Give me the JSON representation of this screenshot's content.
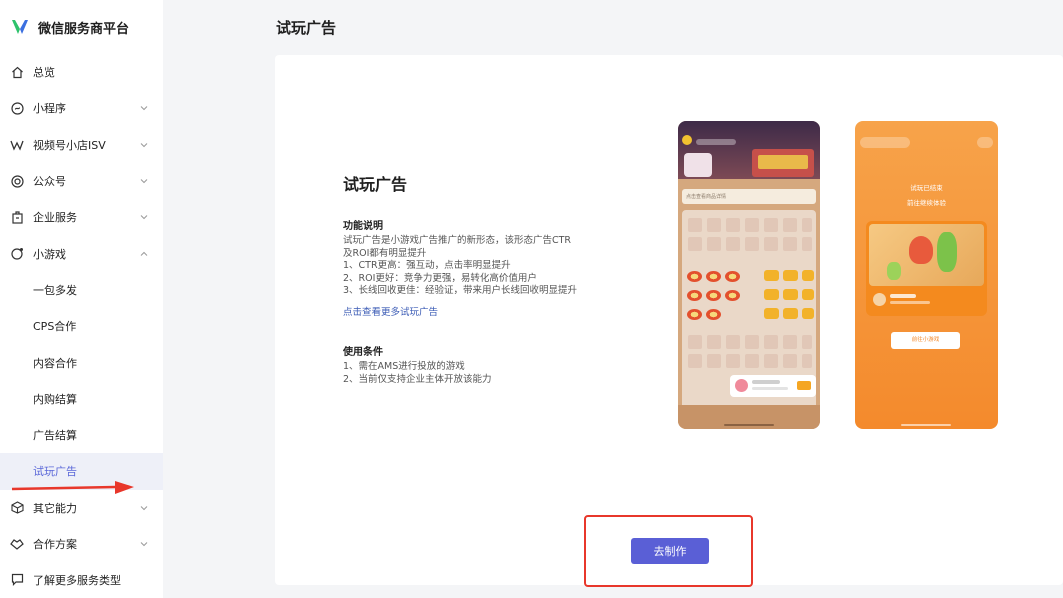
{
  "brand": {
    "title": "微信服务商平台"
  },
  "sidebar": {
    "items": [
      {
        "label": "总览",
        "icon": "home-icon",
        "expandable": false
      },
      {
        "label": "小程序",
        "icon": "mini-program-icon",
        "expandable": true
      },
      {
        "label": "视频号小店ISV",
        "icon": "channels-icon",
        "expandable": true
      },
      {
        "label": "公众号",
        "icon": "official-account-icon",
        "expandable": true
      },
      {
        "label": "企业服务",
        "icon": "enterprise-icon",
        "expandable": true
      },
      {
        "label": "小游戏",
        "icon": "mini-game-icon",
        "expandable": true,
        "expanded": true
      }
    ],
    "subitems": [
      {
        "label": "一包多发"
      },
      {
        "label": "CPS合作"
      },
      {
        "label": "内容合作"
      },
      {
        "label": "内购结算"
      },
      {
        "label": "广告结算"
      },
      {
        "label": "试玩广告",
        "active": true
      }
    ],
    "more_items": [
      {
        "label": "其它能力",
        "icon": "cube-icon",
        "expandable": true
      },
      {
        "label": "合作方案",
        "icon": "handshake-icon",
        "expandable": true
      }
    ],
    "bottom_item": {
      "label": "了解更多服务类型",
      "icon": "message-icon"
    },
    "active_color": "#5a67d8"
  },
  "page": {
    "title": "试玩广告"
  },
  "feature": {
    "title": "试玩广告",
    "desc_heading": "功能说明",
    "desc_lines": [
      "试玩广告是小游戏广告推广的新形态，该形态广告CTR",
      "及ROI都有明显提升",
      "1、CTR更高：强互动，点击率明显提升",
      "2、ROI更好：竞争力更强，易转化高价值用户",
      "3、长线回收更佳：经验证，带来用户长线回收明显提升"
    ],
    "link": "点击查看更多试玩广告",
    "cond_heading": "使用条件",
    "cond_lines": [
      "1、需在AMS进行投放的游戏",
      "2、当前仅支持企业主体开放该能力"
    ]
  },
  "preview": {
    "phone1_search": "点击查看商品详情",
    "phone2_line1": "试玩已结束",
    "phone2_line2": "前往继续体验",
    "phone2_button": "前往小游戏"
  },
  "actions": {
    "make_button": "去制作"
  },
  "colors": {
    "primary": "#5a5fd6",
    "annotation_red": "#e8372b"
  }
}
